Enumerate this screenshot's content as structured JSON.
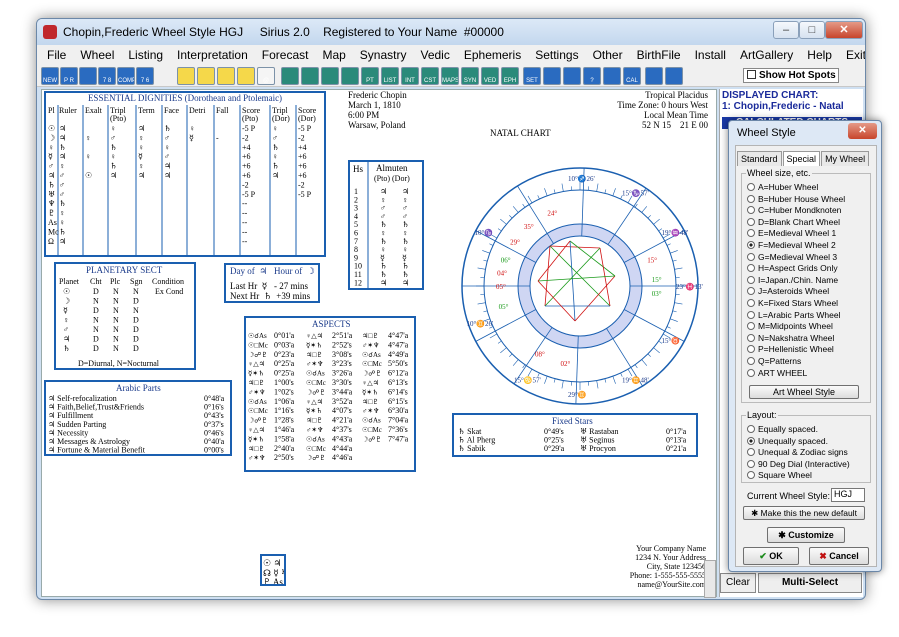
{
  "window": {
    "title": "Chopin,Frederic Wheel Style HGJ     Sirius 2.0    Registered to Your Name  #00000"
  },
  "menu": [
    "File",
    "Wheel",
    "Listing",
    "Interpretation",
    "Forecast",
    "Map",
    "Synastry",
    "Vedic",
    "Ephemeris",
    "Settings",
    "Other",
    "BirthFile",
    "Install",
    "ArtGallery",
    "Help",
    "Exit"
  ],
  "toolbar": {
    "hot_spots": "Show Hot Spots",
    "icons": [
      "NEW",
      "P R",
      "",
      "7 8",
      "COMP",
      "7 6",
      "",
      "",
      "",
      "",
      "@",
      "",
      "",
      "",
      "",
      "PT",
      "LIST",
      "INT",
      "CST",
      "MAPS",
      "SYN",
      "VED",
      "EPH",
      "SET",
      "",
      "",
      "?",
      "",
      "CAL",
      "",
      ""
    ]
  },
  "chart_info": {
    "name": "Frederic Chopin",
    "date": "March 1, 1810",
    "time": "6:00 PM",
    "place": "Warsaw, Poland",
    "house_system": "Tropical Placidus",
    "timezone": "Time Zone: 0 hours West",
    "lmt": "Local Mean Time",
    "coords": "52 N 15    21 E 00",
    "title": "NATAL CHART"
  },
  "dignities": {
    "title": "ESSENTIAL DIGNITIES  (Dorothean and Ptolemaic)",
    "headers": [
      "Pl",
      "Ruler",
      "Exalt",
      "Tripl (Pto)",
      "Term",
      "Face",
      "Detri",
      "Fall",
      "Score (Pto)",
      "Tripl (Dor)",
      "Score (Dor)"
    ],
    "rows": [
      [
        "☉",
        "♃",
        "",
        "♀",
        "♃",
        "♄",
        "♀",
        "",
        "-5 P",
        "♀",
        "-5 P"
      ],
      [
        "☽",
        "♃",
        "♀",
        "♂",
        "♀",
        "♂",
        "☿",
        "-",
        "-2",
        "♂",
        "-2"
      ],
      [
        "♀",
        "♄",
        "",
        "♄",
        "♀",
        "♀",
        "",
        "",
        "+4",
        "♄",
        "+4"
      ],
      [
        "☿",
        "♃",
        "♀",
        "♀",
        "☿",
        "♂",
        "",
        "",
        "+6",
        "♀",
        "+6"
      ],
      [
        "♂",
        "♀",
        "",
        "♄",
        "♀",
        "♃",
        "",
        "",
        "+6",
        "♄",
        "+6"
      ],
      [
        "♃",
        "♂",
        "☉",
        "♃",
        "♃",
        "♃",
        "",
        "",
        "+6",
        "♃",
        "+6"
      ],
      [
        "♄",
        "♂",
        "",
        "",
        "",
        "",
        "",
        "",
        "-2",
        "",
        "-2"
      ],
      [
        "♅",
        "♂",
        "",
        "",
        "",
        "",
        "",
        "",
        "-5 P",
        "",
        "-5 P"
      ],
      [
        "♆",
        "♄",
        "",
        "",
        "",
        "",
        "",
        "",
        "--",
        "",
        ""
      ],
      [
        "♇",
        "♀",
        "",
        "",
        "",
        "",
        "",
        "",
        "--",
        "",
        ""
      ],
      [
        "As",
        "♀",
        "",
        "",
        "",
        "",
        "",
        "",
        "--",
        "",
        ""
      ],
      [
        "Mc",
        "♄",
        "",
        "",
        "",
        "",
        "",
        "",
        "--",
        "",
        ""
      ],
      [
        "Ω",
        "♃",
        "",
        "",
        "",
        "",
        "",
        "",
        "--",
        "",
        ""
      ]
    ]
  },
  "almuten": {
    "title": "Almuten",
    "sub": "(Pto)  (Dor)",
    "houses": [
      "1",
      "2",
      "3",
      "4",
      "5",
      "6",
      "7",
      "8",
      "9",
      "10",
      "11",
      "12"
    ],
    "pto": [
      "♃",
      "♀",
      "♂",
      "♂",
      "♄",
      "♀",
      "♄",
      "♀",
      "☿",
      "♄",
      "♄",
      "♃"
    ],
    "dor": [
      "♃",
      "♀",
      "♂",
      "♂",
      "♄",
      "♀",
      "♄",
      "♀",
      "☿",
      "♄",
      "♄",
      "♃"
    ]
  },
  "sect": {
    "title": "PLANETARY SECT",
    "headers": [
      "Planet",
      "Cht",
      "Plc",
      "Sgn",
      "Condition"
    ],
    "rows": [
      [
        "☉",
        "D",
        "N",
        "N",
        "Ex Cond"
      ],
      [
        "☽",
        "N",
        "N",
        "D",
        ""
      ],
      [
        "☿",
        "D",
        "N",
        "N",
        ""
      ],
      [
        "♀",
        "N",
        "N",
        "D",
        ""
      ],
      [
        "♂",
        "N",
        "N",
        "D",
        ""
      ],
      [
        "♃",
        "D",
        "N",
        "D",
        ""
      ],
      [
        "♄",
        "D",
        "N",
        "D",
        ""
      ]
    ],
    "legend": "D=Diurnal, N=Nocturnal"
  },
  "hour": {
    "title": "Day of  ♃   Hour of  ☽",
    "last": "Last Hr  ☿   - 27 mins",
    "next": "Next Hr  ♄  +39 mins"
  },
  "arabic_parts": {
    "title": "Arabic Parts",
    "rows": [
      [
        "Self-refocalization",
        "0°48'a"
      ],
      [
        "Faith,Belief,Trust&Friends",
        "0°16's"
      ],
      [
        "Fulfillment",
        "0°43's"
      ],
      [
        "Sudden Parting",
        "0°37's"
      ],
      [
        "Necessity",
        "0°46's"
      ],
      [
        "Messages & Astrology",
        "0°40'a"
      ],
      [
        "Fortune & Material Benefit",
        "0°00's"
      ]
    ]
  },
  "aspects": {
    "title": "ASPECTS",
    "col1": [
      "0°01'a",
      "0°03'a",
      "0°23'a",
      "0°25'a",
      "0°25'a",
      "1°00's",
      "1°02's",
      "1°06'a",
      "1°16's",
      "1°28's",
      "1°46'a",
      "1°58'a",
      "2°40'a",
      "2°50's"
    ],
    "col2": [
      "2°51'a",
      "2°52's",
      "3°08's",
      "3°23's",
      "3°26'a",
      "3°30's",
      "3°44'a",
      "3°52'a",
      "4°07's",
      "4°21'a",
      "4°37's",
      "4°43'a",
      "4°44'a",
      "4°46'a"
    ],
    "col3": [
      "4°47'a",
      "4°47'a",
      "4°49'a",
      "5°50's",
      "6°12'a",
      "6°13's",
      "6°14's",
      "6°15's",
      "6°30'a",
      "7°04'a",
      "7°36's",
      "7°47'a"
    ]
  },
  "fixed_stars": {
    "title": "Fixed Stars",
    "rows": [
      [
        "Skat",
        "0°49's",
        "Rastaban",
        "0°17'a"
      ],
      [
        "Al Pherg",
        "0°25's",
        "Seginus",
        "0°13'a"
      ],
      [
        "Sabik",
        "0°29'a",
        "Procyon",
        "0°21'a"
      ]
    ]
  },
  "company": [
    "Your Company Name",
    "1234 N. Your Address",
    "City, State 123456",
    "Phone: 1-555-555-5555",
    "name@YourSite.com"
  ],
  "wheel": {
    "cusps": [
      "10°♐26'",
      "15°♑57'",
      "19°♒48'",
      "23°♓13'",
      "15°♉",
      "19°♊48'",
      "29°♊",
      "15°♋57'",
      "10°♊26'",
      "10°♑"
    ],
    "planets": [
      "24°",
      "35°",
      "29°",
      "15°",
      "15°",
      "03°",
      "06°",
      "05°",
      "05°",
      "04°",
      "02°",
      "08°"
    ]
  },
  "right_panel": {
    "header1": "DISPLAYED CHART:",
    "header2": "1: Chopin,Frederic - Natal",
    "header3": "CALCULATED CHARTS",
    "clear": "Clear",
    "multi": "Multi-Select"
  },
  "dialog": {
    "title": "Wheel Style",
    "tabs": [
      "Standard",
      "Special",
      "My Wheel"
    ],
    "group1": "Wheel size, etc.",
    "options": [
      "A=Huber Wheel",
      "B=Huber House Wheel",
      "C=Huber Mondknoten",
      "D=Blank Chart Wheel",
      "E=Medieval Wheel 1",
      "F=Medieval Wheel 2",
      "G=Medieval Wheel 3",
      "H=Aspect Grids Only",
      "I=Japan./Chin. Name",
      "J=Asteroids Wheel",
      "K=Fixed Stars Wheel",
      "L=Arabic Parts Wheel",
      "M=Midpoints Wheel",
      "N=Nakshatra Wheel",
      "P=Hellenistic Wheel",
      "Q=Patterns",
      "ART WHEEL"
    ],
    "selected": 5,
    "art_btn": "Art Wheel Style",
    "group2": "Layout:",
    "layouts": [
      "Equally spaced.",
      "Unequally spaced.",
      "Unequal & Zodiac signs",
      "90 Deg Dial (Interactive)",
      "Square Wheel"
    ],
    "layout_selected": 1,
    "current_label": "Current Wheel Style:",
    "current_value": "HGJ",
    "make_default": "Make this the new default",
    "customize": "Customize",
    "ok": "OK",
    "cancel": "Cancel"
  }
}
